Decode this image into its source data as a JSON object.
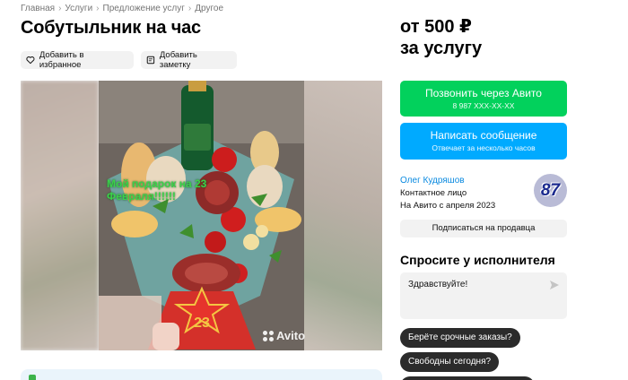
{
  "breadcrumb": {
    "items": [
      "Главная",
      "Услуги",
      "Предложение услуг",
      "Другое"
    ],
    "separator": "›"
  },
  "listing": {
    "title": "Собутыльник на час",
    "favorite_label": "Добавить в избранное",
    "note_label": "Добавить заметку"
  },
  "gallery": {
    "caption": "Мой подарок на 23 Февраля!!!!!!",
    "watermark": "Avito"
  },
  "price": {
    "line1": "от 500 ₽",
    "line2": "за услугу"
  },
  "contact": {
    "call_label": "Позвонить через Авито",
    "call_sub": "8 987 XXX-XX-XX",
    "message_label": "Написать сообщение",
    "message_sub": "Отвечает за несколько часов"
  },
  "seller": {
    "name": "Олег Кудряшов",
    "role": "Контактное лицо",
    "since": "На Авито с апреля 2023",
    "avatar_text": "87",
    "subscribe_label": "Подписаться на продавца"
  },
  "ask": {
    "title": "Спросите у исполнителя",
    "input_value": "Здравствуйте!",
    "quick_replies": [
      "Берёте срочные заказы?",
      "Свободны сегодня?",
      ""
    ]
  },
  "colors": {
    "call_green": "#02d15c",
    "message_blue": "#00aaff",
    "link_blue": "#0a8ae0",
    "chip_gray": "#f2f2f2",
    "quick_dark": "#2b2b2b"
  },
  "icons": {
    "favorite": "heart-icon",
    "note": "note-icon",
    "send": "send-icon"
  }
}
